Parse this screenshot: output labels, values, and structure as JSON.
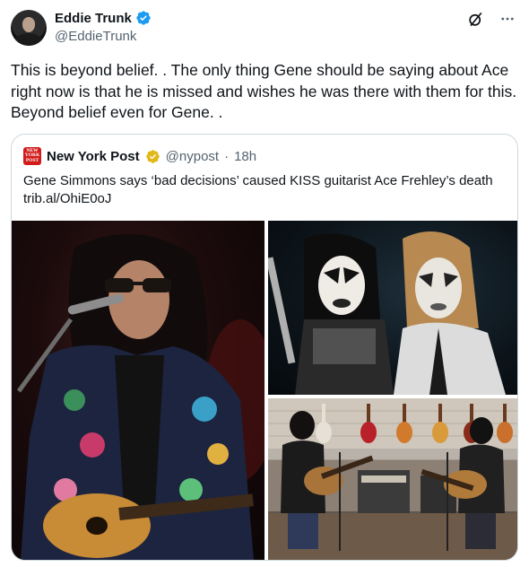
{
  "author": {
    "display_name": "Eddie Trunk",
    "handle": "@EddieTrunk",
    "verified_color": "#1d9bf0"
  },
  "top_icons": [
    "grok-icon",
    "more-icon"
  ],
  "tweet": {
    "text": "This is beyond belief. . The only thing Gene should be saying about Ace right now is that he is missed and wishes he was there with them for this. Beyond belief even for Gene. ."
  },
  "quote": {
    "logo_text": "NEW YORK POST",
    "name": "New York Post",
    "handle": "@nypost",
    "separator": "·",
    "time": "18h",
    "verified_color": "#e2b719",
    "text_line1": "Gene Simmons says ‘bad decisions’ caused KISS guitarist Ace Frehley’s death",
    "text_line2": "trib.al/OhiE0oJ"
  },
  "colors": {
    "text": "#0f1419",
    "secondary": "#536471",
    "border": "#cfd9de",
    "nypost_red": "#d21c1c"
  }
}
